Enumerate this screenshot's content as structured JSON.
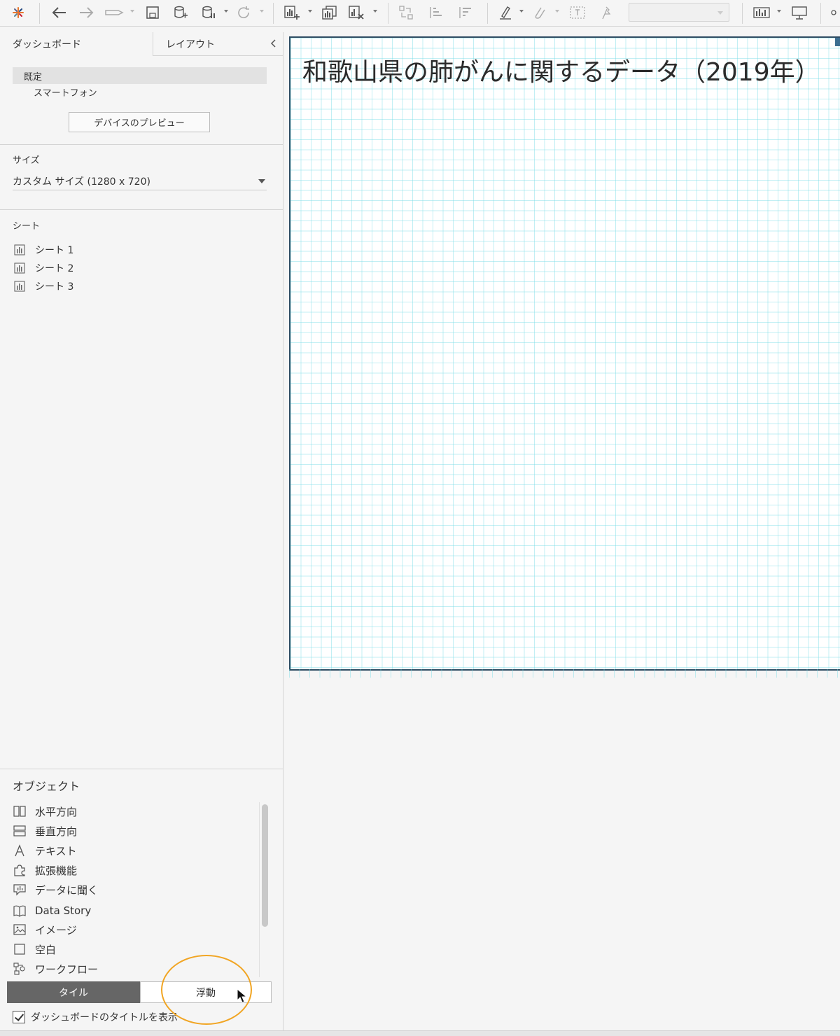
{
  "toolbar": {
    "icons": [
      "tableau-logo-icon",
      "undo-icon",
      "redo-icon",
      "replay-icon",
      "save-icon",
      "new-datasource-icon",
      "pause-update-icon",
      "refresh-icon",
      "new-worksheet-icon",
      "duplicate-sheet-icon",
      "clear-sheet-icon",
      "swap-icon",
      "sort-asc-icon",
      "sort-desc-icon",
      "highlight-icon",
      "annotate-icon",
      "fix-axes-icon",
      "pin-icon",
      "show-me-icon",
      "presentation-icon"
    ],
    "fit_dropdown": ""
  },
  "left_panel": {
    "tabs": {
      "dashboard": "ダッシュボード",
      "layout": "レイアウト"
    },
    "devices": {
      "default": "既定",
      "phone": "スマートフォン"
    },
    "preview_button": "デバイスのプレビュー",
    "size": {
      "label": "サイズ",
      "value": "カスタム サイズ (1280 x 720)"
    },
    "sheets": {
      "label": "シート",
      "items": [
        "シート 1",
        "シート 2",
        "シート 3"
      ]
    },
    "objects": {
      "label": "オブジェクト",
      "items": [
        {
          "label": "水平方向",
          "icon": "horizontal-container-icon"
        },
        {
          "label": "垂直方向",
          "icon": "vertical-container-icon"
        },
        {
          "label": "テキスト",
          "icon": "text-icon"
        },
        {
          "label": "拡張機能",
          "icon": "extension-icon"
        },
        {
          "label": "データに聞く",
          "icon": "ask-data-icon"
        },
        {
          "label": "Data Story",
          "icon": "data-story-icon"
        },
        {
          "label": "イメージ",
          "icon": "image-icon"
        },
        {
          "label": "空白",
          "icon": "blank-icon"
        },
        {
          "label": "ワークフロー",
          "icon": "workflow-icon"
        }
      ]
    },
    "placement": {
      "tile": "タイル",
      "floating": "浮動",
      "selected": "tile"
    },
    "show_title": {
      "label": "ダッシュボードのタイトルを表示",
      "checked": true
    }
  },
  "canvas": {
    "title": "和歌山県の肺がんに関するデータ（2019年）"
  },
  "colors": {
    "frame_border": "#2e4d63",
    "grid": "#78dce6",
    "highlight": "#f1a523",
    "tile_selected": "#666666"
  }
}
